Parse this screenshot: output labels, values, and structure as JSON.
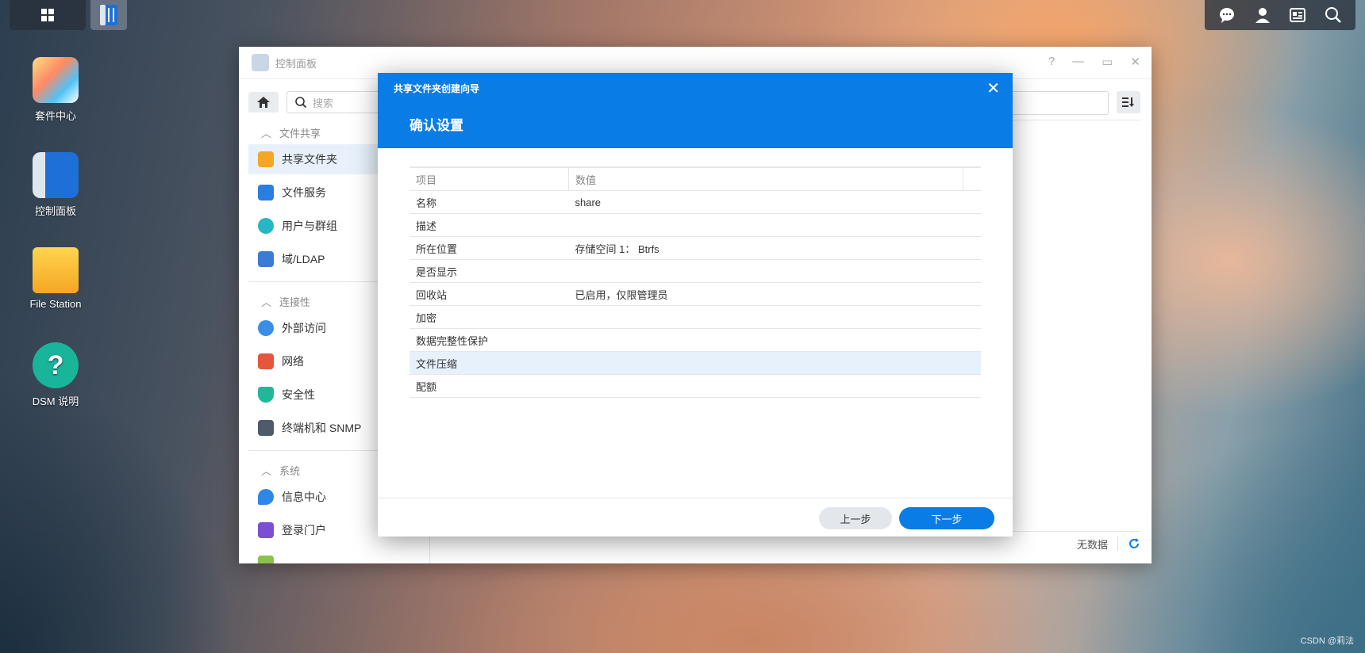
{
  "desktop": {
    "icons": [
      {
        "label": "套件中心"
      },
      {
        "label": "控制面板"
      },
      {
        "label": "File Station"
      },
      {
        "label": "DSM 说明"
      }
    ]
  },
  "control_panel": {
    "title": "控制面板",
    "search_placeholder": "搜索",
    "sections": {
      "file_sharing": "文件共享",
      "connectivity": "连接性",
      "system": "系统"
    },
    "items": [
      {
        "label": "共享文件夹"
      },
      {
        "label": "文件服务"
      },
      {
        "label": "用户与群组"
      },
      {
        "label": "域/LDAP"
      },
      {
        "label": "外部访问"
      },
      {
        "label": "网络"
      },
      {
        "label": "安全性"
      },
      {
        "label": "终端机和 SNMP"
      },
      {
        "label": "信息中心"
      },
      {
        "label": "登录门户"
      }
    ],
    "footer_status": "无数据"
  },
  "wizard": {
    "title": "共享文件夹创建向导",
    "step_title": "确认设置",
    "table": {
      "headers": [
        "项目",
        "数值"
      ],
      "rows": [
        {
          "item": "名称",
          "value": "share"
        },
        {
          "item": "描述",
          "value": ""
        },
        {
          "item": "所在位置",
          "value": "存储空间 1： Btrfs"
        },
        {
          "item": "是否显示",
          "value": ""
        },
        {
          "item": "回收站",
          "value": "已启用，仅限管理员"
        },
        {
          "item": "加密",
          "value": ""
        },
        {
          "item": "数据完整性保护",
          "value": ""
        },
        {
          "item": "文件压缩",
          "value": ""
        },
        {
          "item": "配额",
          "value": ""
        }
      ]
    },
    "buttons": {
      "prev": "上一步",
      "next": "下一步"
    }
  },
  "watermark": "CSDN @莉法",
  "colors": {
    "accent": "#0a7ce6",
    "highlight_row": "#e6f1fc"
  }
}
